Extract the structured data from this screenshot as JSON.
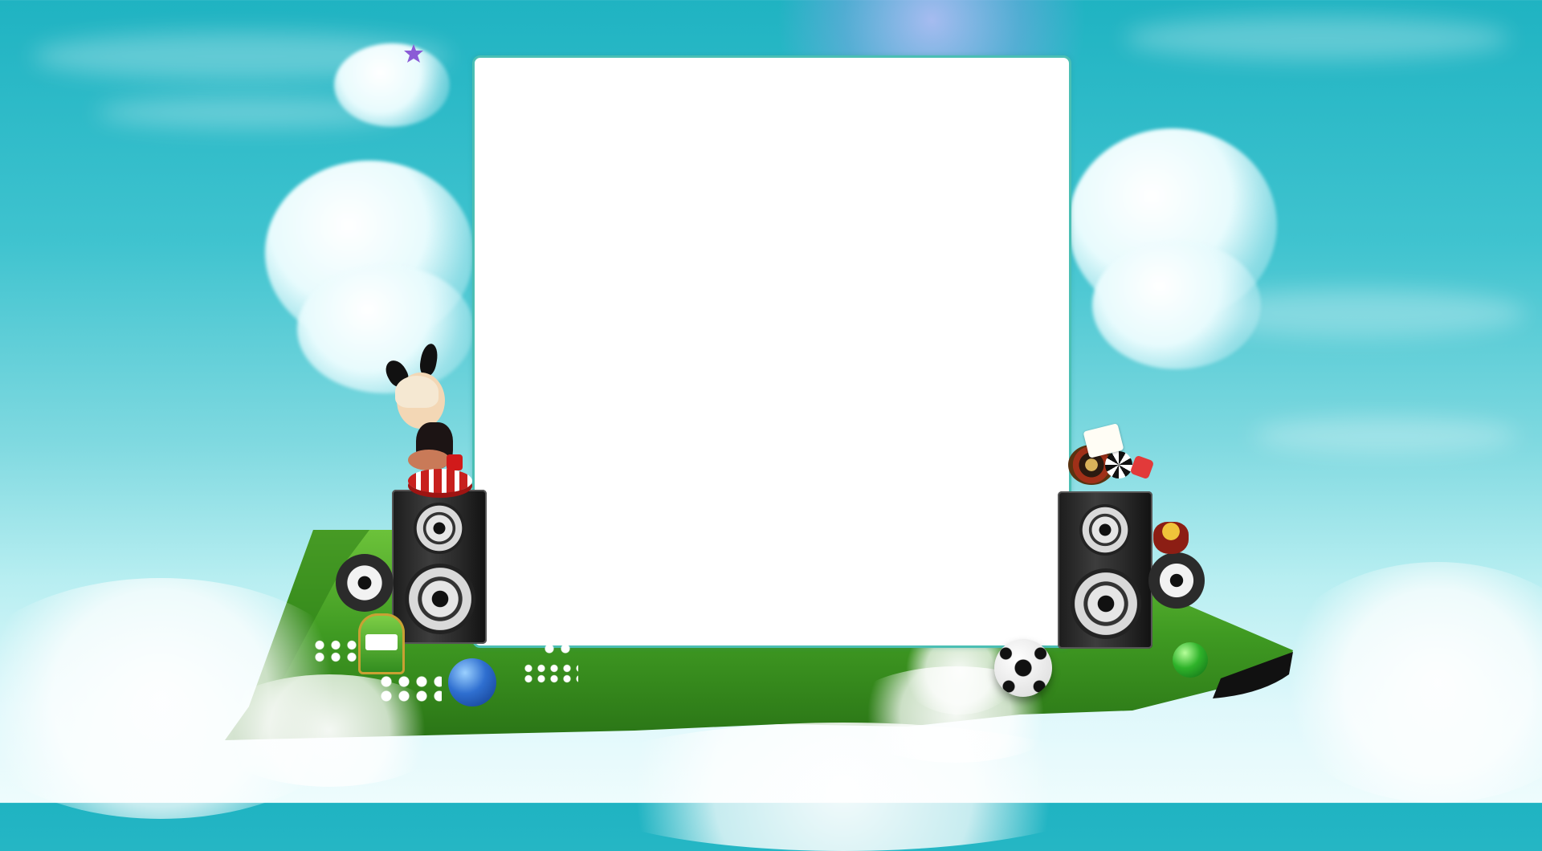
{
  "scene": {
    "type": "decorative-game-landing-background",
    "colors": {
      "sky_top": "#1fb3c2",
      "sky_bottom": "#eefcfd",
      "panel_fill": "#ffffff",
      "panel_border": "#4bbfb4",
      "grass": "#3f9a22"
    },
    "icons": {
      "star": "star-icon",
      "speaker": "speaker-icon",
      "soccer_ball": "soccer-ball-icon",
      "lottery_ball_blue": "lottery-ball-icon",
      "lottery_ball_green": "lottery-ball-icon",
      "slot_machine": "slot-machine-icon",
      "roulette": "roulette-wheel-icon",
      "poker_chip": "poker-chip-icon",
      "dice": "dice-icon",
      "cards": "playing-cards-icon",
      "character": "bunny-girl-mascot-icon"
    }
  }
}
